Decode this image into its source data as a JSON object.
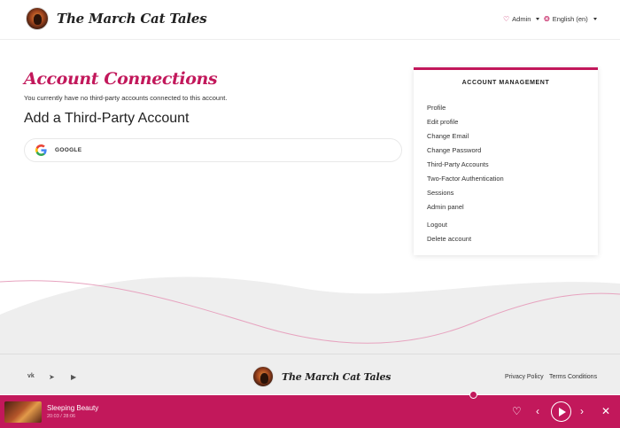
{
  "brand": {
    "name": "The March Cat Tales"
  },
  "header": {
    "admin_label": "Admin",
    "language_label": "English (en)"
  },
  "main": {
    "title": "Account Connections",
    "subtitle": "You currently have no third-party accounts connected to this account.",
    "add_heading": "Add a Third-Party Account",
    "provider_label": "GOOGLE"
  },
  "account_menu": {
    "title": "ACCOUNT MANAGEMENT",
    "items": [
      "Profile",
      "Edit profile",
      "Change Email",
      "Change Password",
      "Third-Party Accounts",
      "Two-Factor Authentication",
      "Sessions",
      "Admin panel"
    ],
    "logout": "Logout",
    "delete": "Delete account"
  },
  "footer": {
    "privacy": "Privacy Policy",
    "terms": "Terms Conditions"
  },
  "player": {
    "track_title": "Sleeping Beauty",
    "track_time": "20:03 / 28:06"
  },
  "colors": {
    "accent": "#c2185b",
    "footer_bg": "#eeeeee"
  }
}
